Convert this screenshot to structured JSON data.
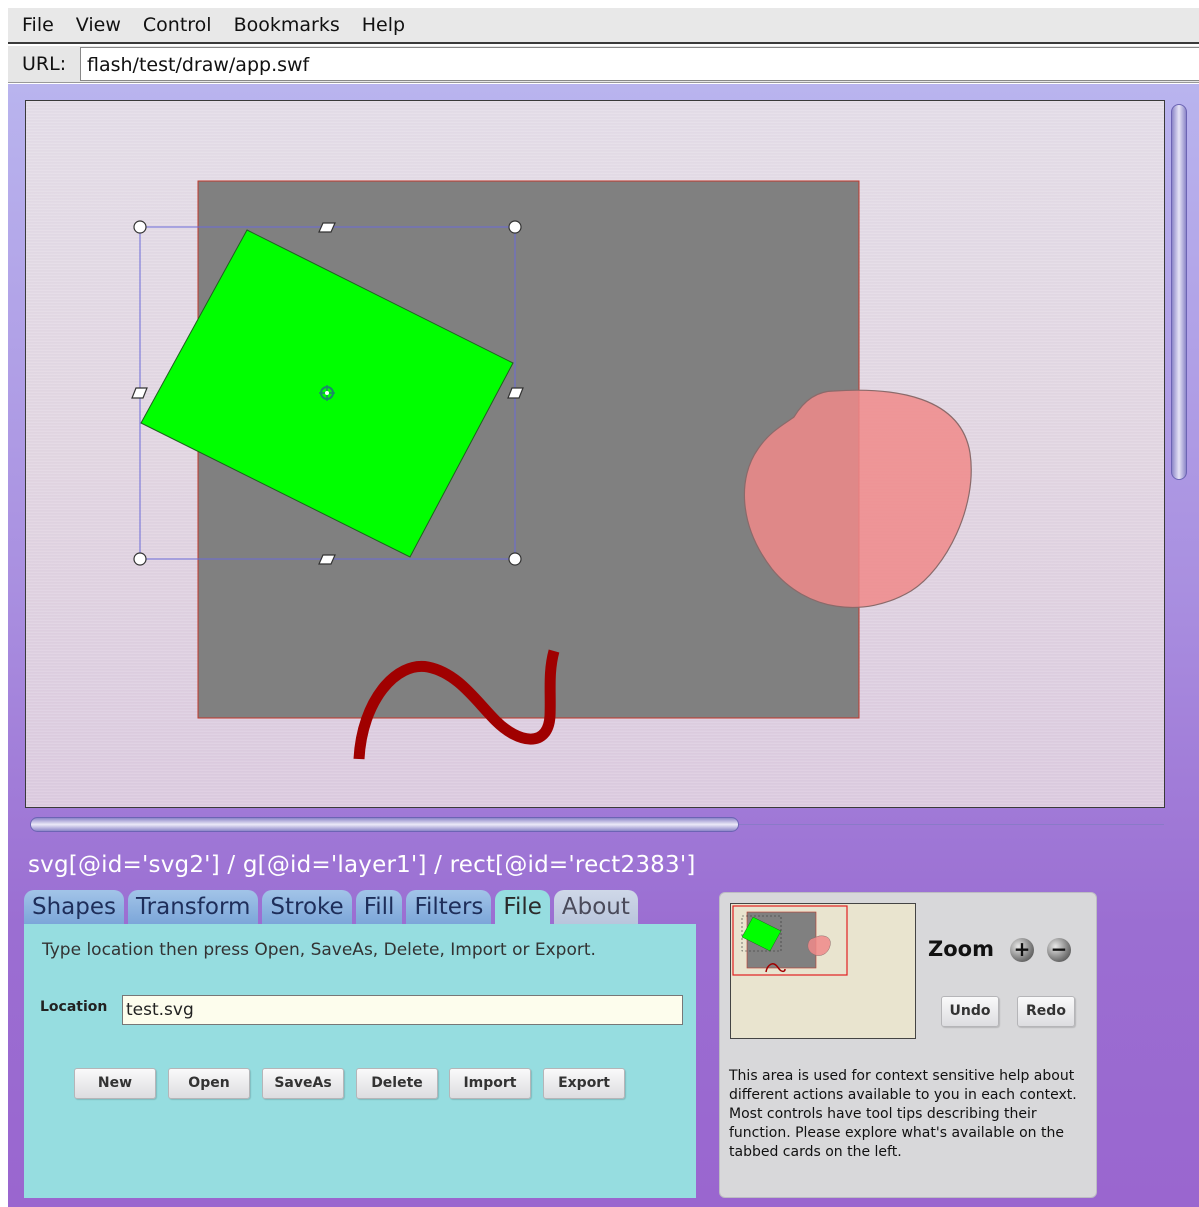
{
  "menubar": {
    "items": [
      "File",
      "View",
      "Control",
      "Bookmarks",
      "Help"
    ]
  },
  "urlbar": {
    "label": "URL:",
    "value": "flash/test/draw/app.swf"
  },
  "xpath": "svg[@id='svg2'] / g[@id='layer1'] / rect[@id='rect2383']",
  "tabs": [
    {
      "label": "Shapes"
    },
    {
      "label": "Transform"
    },
    {
      "label": "Stroke"
    },
    {
      "label": "Fill"
    },
    {
      "label": "Filters"
    },
    {
      "label": "File"
    },
    {
      "label": "About"
    }
  ],
  "active_tab": "File",
  "file_panel": {
    "instructions": "Type location then press Open, SaveAs, Delete, Import or Export.",
    "location_label": "Location",
    "location_value": "test.svg",
    "buttons": [
      "New",
      "Open",
      "SaveAs",
      "Delete",
      "Import",
      "Export"
    ]
  },
  "nav_panel": {
    "zoom_label": "Zoom",
    "zoom_in_glyph": "+",
    "zoom_out_glyph": "−",
    "undo_label": "Undo",
    "redo_label": "Redo",
    "help_text": "This area is used for context sensitive help about different actions available to you in each context. Most controls have tool tips describing their function. Please explore what's available on the tabbed cards on the left."
  },
  "colors": {
    "gray_rect_fill": "#808080",
    "gray_rect_stroke": "#c0392b",
    "green_rect_fill": "#00ff00",
    "blob_fill": "#f08a8a",
    "squiggle_stroke": "#a00000",
    "selection_box": "#6a6ad8",
    "file_panel_bg": "#96dde0",
    "tab_bg": "#7ca6d9"
  }
}
